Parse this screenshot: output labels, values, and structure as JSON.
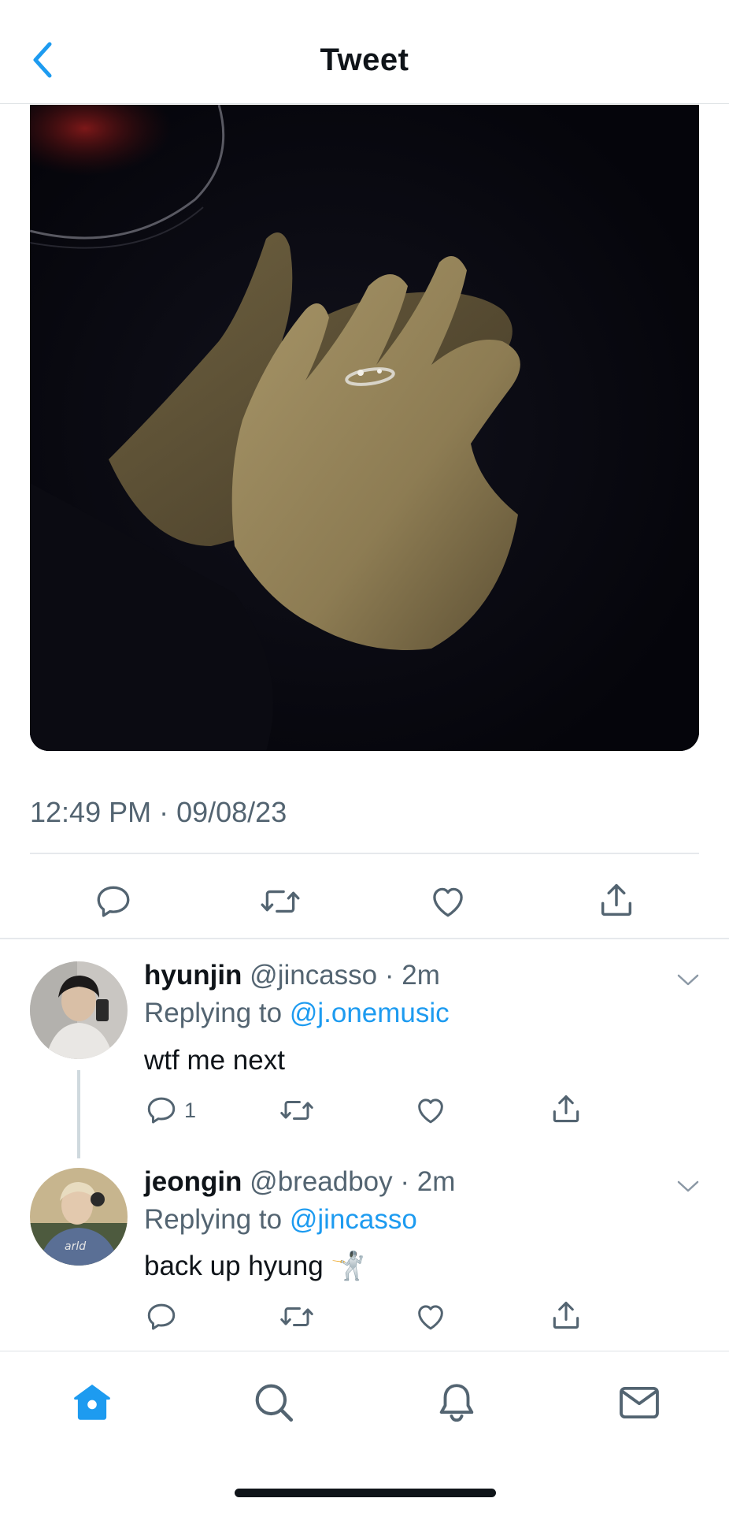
{
  "header": {
    "title": "Tweet",
    "back_icon": "chevron-left-icon"
  },
  "tweet": {
    "media_description": "photo",
    "timestamp": "12:49 PM · 09/08/23",
    "actions": [
      "reply-icon",
      "retweet-icon",
      "like-icon",
      "share-icon"
    ]
  },
  "replies": [
    {
      "name": "hyunjin",
      "meta": "@jincasso · 2m",
      "replying_prefix": "Replying to ",
      "replying_handle": "@j.onemusic",
      "text": "wtf me next",
      "reply_count": "1"
    },
    {
      "name": "jeongin",
      "meta": "@breadboy · 2m",
      "replying_prefix": "Replying to ",
      "replying_handle": "@jincasso",
      "text": "back up hyung 🤺",
      "reply_count": ""
    }
  ],
  "bottom_nav": [
    "home-icon",
    "search-icon",
    "notifications-icon",
    "messages-icon"
  ],
  "colors": {
    "accent": "#1d9bf0",
    "secondary_text": "#536471",
    "divider": "#e6e9ec"
  }
}
